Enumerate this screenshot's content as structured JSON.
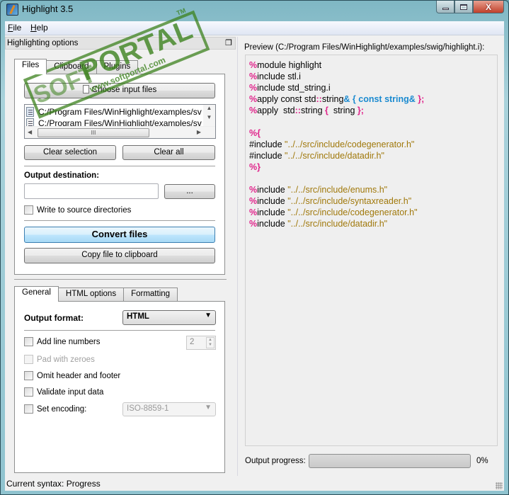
{
  "window": {
    "title": "Highlight 3.5",
    "controls": {
      "minimize": "minimize",
      "maximize": "maximize",
      "close": "X"
    }
  },
  "menu": [
    {
      "label": "File",
      "accel": "F"
    },
    {
      "label": "Help",
      "accel": "H"
    }
  ],
  "dock": {
    "title": "Highlighting options",
    "float_icon": "❐"
  },
  "input_tabs": [
    {
      "label": "Files",
      "active": true
    },
    {
      "label": "Clipboard",
      "active": false
    },
    {
      "label": "Plugins",
      "active": false
    }
  ],
  "files_tab": {
    "choose_button": "Choose input files",
    "files": [
      "C:/Program Files/WinHighlight/examples/swig/highlight.i",
      "C:/Program Files/WinHighlight/examples/swig/makefile"
    ],
    "files_visible": [
      "C:/Program Files/WinHighlight/examples/sv",
      "C:/Program Files/WinHighlight/examples/sv"
    ],
    "scroll_thumb_glyph": "III",
    "clear_selection": "Clear selection",
    "clear_all": "Clear all",
    "output_destination_label": "Output destination:",
    "output_destination_value": "",
    "browse_button": "...",
    "write_to_source_label": "Write to source directories",
    "write_to_source_checked": false,
    "convert_button": "Convert files",
    "copy_button": "Copy file to clipboard"
  },
  "option_tabs": [
    {
      "label": "General",
      "active": true
    },
    {
      "label": "HTML options",
      "active": false
    },
    {
      "label": "Formatting",
      "active": false
    }
  ],
  "general": {
    "output_format_label": "Output format:",
    "output_format_value": "HTML",
    "add_line_numbers": {
      "label": "Add line numbers",
      "checked": false
    },
    "line_number_width": "2",
    "pad_with_zeroes": {
      "label": "Pad with zeroes",
      "checked": false,
      "disabled": true
    },
    "omit_header_footer": {
      "label": "Omit header and footer",
      "checked": false
    },
    "validate_input": {
      "label": "Validate input data",
      "checked": false
    },
    "set_encoding": {
      "label": "Set encoding:",
      "checked": false
    },
    "encoding_value": "ISO-8859-1"
  },
  "preview": {
    "label": "Preview (C:/Program Files/WinHighlight/examples/swig/highlight.i):",
    "lines": [
      [
        {
          "t": "%",
          "c": "pct"
        },
        {
          "t": "module highlight",
          "c": ""
        }
      ],
      [
        {
          "t": "%",
          "c": "pct"
        },
        {
          "t": "include stl.i",
          "c": ""
        }
      ],
      [
        {
          "t": "%",
          "c": "pct"
        },
        {
          "t": "include std_string.i",
          "c": ""
        }
      ],
      [
        {
          "t": "%",
          "c": "pct"
        },
        {
          "t": "apply const std",
          "c": ""
        },
        {
          "t": "::",
          "c": "k"
        },
        {
          "t": "string",
          "c": ""
        },
        {
          "t": "& { const string& ",
          "c": "b"
        },
        {
          "t": "};",
          "c": "k"
        }
      ],
      [
        {
          "t": "%",
          "c": "pct"
        },
        {
          "t": "apply  std",
          "c": ""
        },
        {
          "t": "::",
          "c": "k"
        },
        {
          "t": "string ",
          "c": ""
        },
        {
          "t": "{",
          "c": "k"
        },
        {
          "t": "  string ",
          "c": ""
        },
        {
          "t": "};",
          "c": "k"
        }
      ],
      [],
      [
        {
          "t": "%{",
          "c": "pct"
        }
      ],
      [
        {
          "t": "#include ",
          "c": ""
        },
        {
          "t": "\"../../src/include/codegenerator.h\"",
          "c": "s"
        }
      ],
      [
        {
          "t": "#include ",
          "c": ""
        },
        {
          "t": "\"../../src/include/datadir.h\"",
          "c": "s"
        }
      ],
      [
        {
          "t": "%}",
          "c": "pct"
        }
      ],
      [],
      [
        {
          "t": "%",
          "c": "pct"
        },
        {
          "t": "include ",
          "c": ""
        },
        {
          "t": "\"../../src/include/enums.h\"",
          "c": "s"
        }
      ],
      [
        {
          "t": "%",
          "c": "pct"
        },
        {
          "t": "include ",
          "c": ""
        },
        {
          "t": "\"../../src/include/syntaxreader.h\"",
          "c": "s"
        }
      ],
      [
        {
          "t": "%",
          "c": "pct"
        },
        {
          "t": "include ",
          "c": ""
        },
        {
          "t": "\"../../src/include/codegenerator.h\"",
          "c": "s"
        }
      ],
      [
        {
          "t": "%",
          "c": "pct"
        },
        {
          "t": "include ",
          "c": ""
        },
        {
          "t": "\"../../src/include/datadir.h\"",
          "c": "s"
        }
      ]
    ]
  },
  "progress": {
    "label": "Output progress:",
    "value_percent": 0,
    "value_text": "0%"
  },
  "status": {
    "text": "Current syntax: Progress"
  },
  "watermark": {
    "brand": "PORTAL",
    "prefix": "SOFT",
    "url": "www.softportal.com",
    "tm": "TM"
  },
  "colors": {
    "keyword": "#e0228a",
    "string": "#a0780a",
    "operator_blue": "#1a8ad0",
    "primary_button": "#bee6fd"
  }
}
